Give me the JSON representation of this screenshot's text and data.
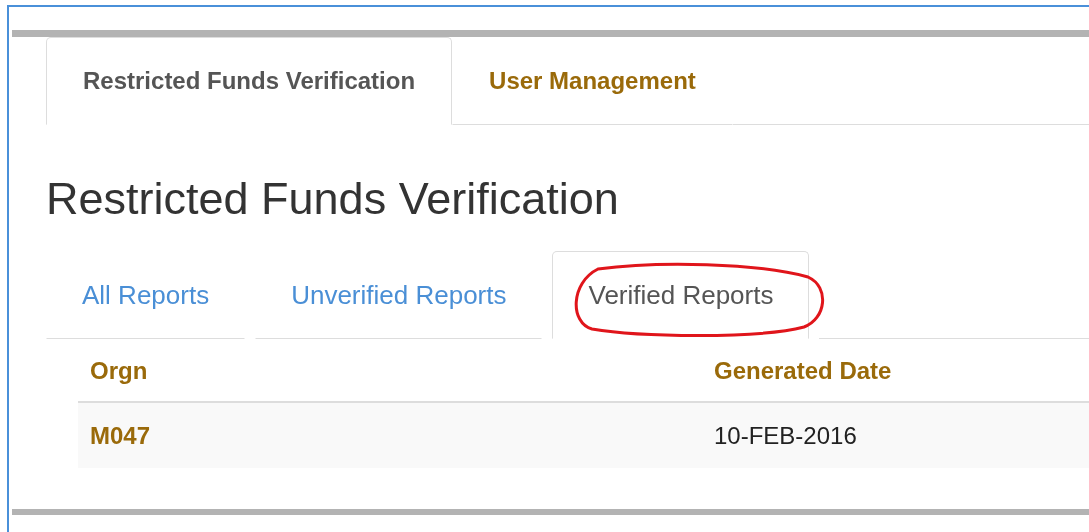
{
  "tabs": [
    {
      "label": "Restricted Funds Verification",
      "selected": true
    },
    {
      "label": "User Management",
      "selected": false
    }
  ],
  "page_title": "Restricted Funds Verification",
  "subtabs": [
    {
      "label": "All Reports",
      "selected": false
    },
    {
      "label": "Unverified Reports",
      "selected": false
    },
    {
      "label": "Verified Reports",
      "selected": true,
      "circled": true
    }
  ],
  "table": {
    "columns": [
      "Orgn",
      "Generated Date"
    ],
    "rows": [
      [
        "M047",
        "10-FEB-2016"
      ]
    ]
  }
}
